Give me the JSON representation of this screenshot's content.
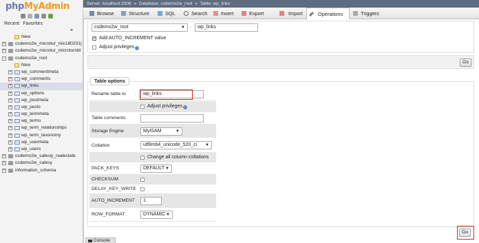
{
  "nav": {
    "logo_a": "php",
    "logo_b": "MyAdmin",
    "tabs": [
      "Recent",
      "Favorites"
    ],
    "link_icon": "chain-link-icon",
    "tree": [
      {
        "label": "New",
        "type": "new",
        "indent": 1
      },
      {
        "label": "csdemo2w_microtur_mic180201(",
        "type": "db",
        "indent": 0
      },
      {
        "label": "csdemo2w_microtur_microturnbl",
        "type": "db",
        "indent": 0
      },
      {
        "label": "csdemo2w_root",
        "type": "db",
        "indent": 0,
        "open": true
      },
      {
        "label": "New",
        "type": "new",
        "indent": 1
      },
      {
        "label": "wp_commentmeta",
        "type": "table",
        "indent": 1
      },
      {
        "label": "wp_comments",
        "type": "table",
        "indent": 1
      },
      {
        "label": "wp_links",
        "type": "table",
        "indent": 1,
        "selected": true
      },
      {
        "label": "wp_options",
        "type": "table",
        "indent": 1
      },
      {
        "label": "wp_postmeta",
        "type": "table",
        "indent": 1
      },
      {
        "label": "wp_posts",
        "type": "table",
        "indent": 1
      },
      {
        "label": "wp_termmeta",
        "type": "table",
        "indent": 1
      },
      {
        "label": "wp_terms",
        "type": "table",
        "indent": 1
      },
      {
        "label": "wp_term_relationships",
        "type": "table",
        "indent": 1
      },
      {
        "label": "wp_term_taxonomy",
        "type": "table",
        "indent": 1
      },
      {
        "label": "wp_usermeta",
        "type": "table",
        "indent": 1
      },
      {
        "label": "wp_users",
        "type": "table",
        "indent": 1
      },
      {
        "label": "csdemo2w_salesiy_realestate",
        "type": "db",
        "indent": 0
      },
      {
        "label": "csdemo2w_salesy",
        "type": "db",
        "indent": 0
      },
      {
        "label": "information_schema",
        "type": "db",
        "indent": 0
      }
    ]
  },
  "breadcrumb": {
    "server": "Server: localhost:3306",
    "sep": "»",
    "database": "Database: csdemo2w_root",
    "table": "Table: wp_links"
  },
  "menu": {
    "tabs": [
      {
        "label": "Browse",
        "icon": "browse-icon"
      },
      {
        "label": "Structure",
        "icon": "structure-icon"
      },
      {
        "label": "SQL",
        "icon": "sql-icon"
      },
      {
        "label": "Search",
        "icon": "search-icon"
      },
      {
        "label": "Insert",
        "icon": "insert-icon"
      },
      {
        "label": "Export",
        "icon": "export-icon"
      },
      {
        "label": "Import",
        "icon": "import-icon"
      },
      {
        "label": "Operations",
        "icon": "wrench-icon",
        "active": true
      },
      {
        "label": "Triggers",
        "icon": "triggers-icon"
      }
    ]
  },
  "move": {
    "db_select": "csdemo2w_root",
    "dot": ".",
    "table_name": "wp_links",
    "auto_increment_label": "Add AUTO_INCREMENT value",
    "auto_increment_checked": true,
    "adjust_label": "Adjust privileges",
    "adjust_checked": false
  },
  "go_label": "Go",
  "options": {
    "legend": "Table options",
    "rename_label": "Rename table to",
    "rename_value": "wp_links",
    "adjust_label": "Adjust privileges",
    "comments_label": "Table comments",
    "comments_value": "",
    "engine_label": "Storage Engine",
    "engine_value": "MyISAM",
    "collation_label": "Collation",
    "collation_value": "utf8mb4_unicode_520_ci",
    "change_cols_label": "Change all column collations",
    "pack_keys_label": "PACK_KEYS",
    "pack_keys_value": "DEFAULT",
    "checksum_label": "CHECKSUM",
    "delay_label": "DELAY_KEY_WRITE",
    "autoinc_label": "AUTO_INCREMENT",
    "autoinc_value": "1",
    "row_format_label": "ROW_FORMAT",
    "row_format_value": "DYNAMIC"
  },
  "console_label": "Console",
  "colors": {
    "accent_red": "#d0262b",
    "breadcrumb_bg": "#5d6c7e",
    "logo_blue": "#6c78af",
    "logo_orange": "#f29b1c"
  }
}
